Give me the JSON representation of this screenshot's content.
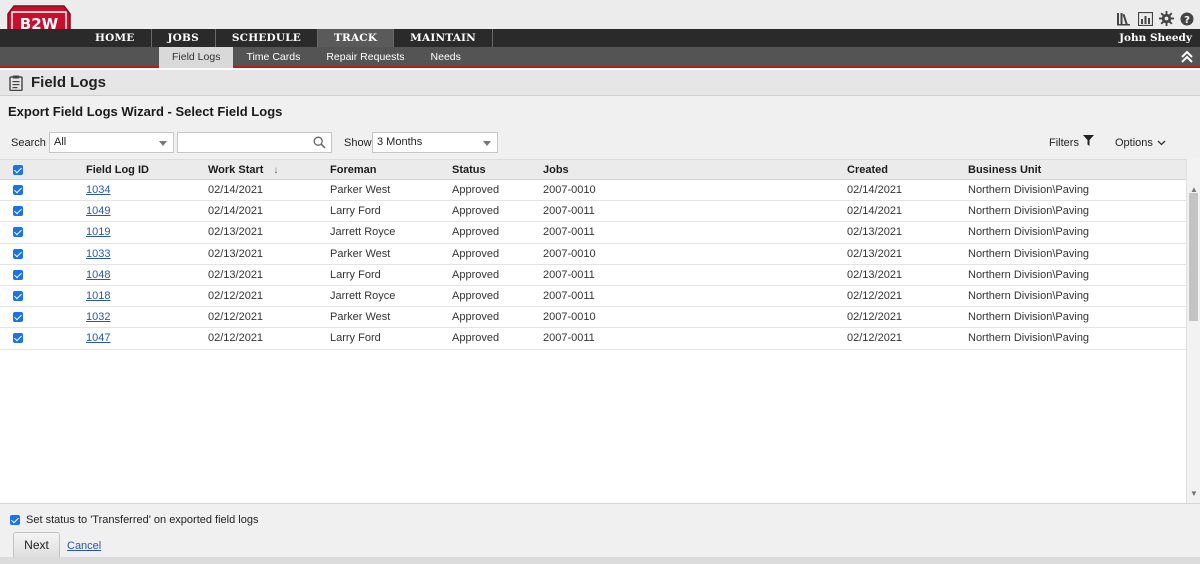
{
  "app": {
    "logo_text": "B2W",
    "user_name": "John Sheedy",
    "icons": [
      "library-icon",
      "report-icon",
      "gear-icon",
      "help-icon"
    ]
  },
  "main_nav": [
    {
      "label": "HOME",
      "active": false
    },
    {
      "label": "JOBS",
      "active": false
    },
    {
      "label": "SCHEDULE",
      "active": false
    },
    {
      "label": "TRACK",
      "active": true
    },
    {
      "label": "MAINTAIN",
      "active": false
    }
  ],
  "sub_nav": [
    {
      "label": "Field Logs",
      "active": true
    },
    {
      "label": "Time Cards",
      "active": false
    },
    {
      "label": "Repair Requests",
      "active": false
    },
    {
      "label": "Needs",
      "active": false
    }
  ],
  "page": {
    "title": "Field Logs",
    "wizard_title": "Export Field Logs Wizard - Select Field Logs"
  },
  "toolbar": {
    "search_label": "Search",
    "search_scope": "All",
    "search_value": "",
    "show_label": "Show",
    "show_value": "3 Months",
    "filters_label": "Filters",
    "options_label": "Options"
  },
  "table": {
    "columns": [
      "Field Log ID",
      "Work Start",
      "Foreman",
      "Status",
      "Jobs",
      "Created",
      "Business Unit"
    ],
    "sort_column": "Work Start",
    "sort_direction": "↓",
    "rows": [
      {
        "id": "1034",
        "work_start": "02/14/2021",
        "foreman": "Parker West",
        "status": "Approved",
        "jobs": "2007-0010",
        "created": "02/14/2021",
        "business_unit": "Northern Division\\Paving"
      },
      {
        "id": "1049",
        "work_start": "02/14/2021",
        "foreman": "Larry Ford",
        "status": "Approved",
        "jobs": "2007-0011",
        "created": "02/14/2021",
        "business_unit": "Northern Division\\Paving"
      },
      {
        "id": "1019",
        "work_start": "02/13/2021",
        "foreman": "Jarrett Royce",
        "status": "Approved",
        "jobs": "2007-0011",
        "created": "02/13/2021",
        "business_unit": "Northern Division\\Paving"
      },
      {
        "id": "1033",
        "work_start": "02/13/2021",
        "foreman": "Parker West",
        "status": "Approved",
        "jobs": "2007-0010",
        "created": "02/13/2021",
        "business_unit": "Northern Division\\Paving"
      },
      {
        "id": "1048",
        "work_start": "02/13/2021",
        "foreman": "Larry Ford",
        "status": "Approved",
        "jobs": "2007-0011",
        "created": "02/13/2021",
        "business_unit": "Northern Division\\Paving"
      },
      {
        "id": "1018",
        "work_start": "02/12/2021",
        "foreman": "Jarrett Royce",
        "status": "Approved",
        "jobs": "2007-0011",
        "created": "02/12/2021",
        "business_unit": "Northern Division\\Paving"
      },
      {
        "id": "1032",
        "work_start": "02/12/2021",
        "foreman": "Parker West",
        "status": "Approved",
        "jobs": "2007-0010",
        "created": "02/12/2021",
        "business_unit": "Northern Division\\Paving"
      },
      {
        "id": "1047",
        "work_start": "02/12/2021",
        "foreman": "Larry Ford",
        "status": "Approved",
        "jobs": "2007-0011",
        "created": "02/12/2021",
        "business_unit": "Northern Division\\Paving"
      }
    ]
  },
  "footer": {
    "transfer_checkbox_label": "Set status to 'Transferred' on exported field logs",
    "transfer_checked": true,
    "next_label": "Next",
    "cancel_label": "Cancel"
  },
  "colors": {
    "accent_red": "#b21f1f",
    "nav_dark": "#2a2a2a",
    "checkbox_blue": "#1a73e8",
    "link_blue": "#2a56a6"
  }
}
